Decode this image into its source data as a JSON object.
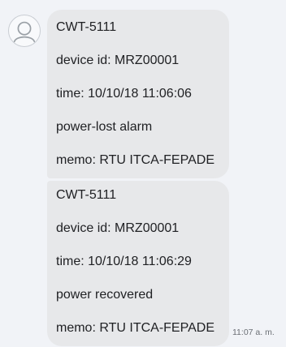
{
  "thread": {
    "messages": [
      {
        "lines": [
          "CWT-5111",
          "device id: MRZ00001",
          "time: 10/10/18 11:06:06",
          "power-lost alarm",
          "memo: RTU ITCA-FEPADE"
        ]
      },
      {
        "lines": [
          "CWT-5111",
          "device id: MRZ00001",
          "time: 10/10/18 11:06:29",
          "power recovered",
          "memo: RTU ITCA-FEPADE"
        ],
        "timestamp": "11:07 a. m."
      }
    ],
    "sender_avatar_icon": "person-icon"
  }
}
